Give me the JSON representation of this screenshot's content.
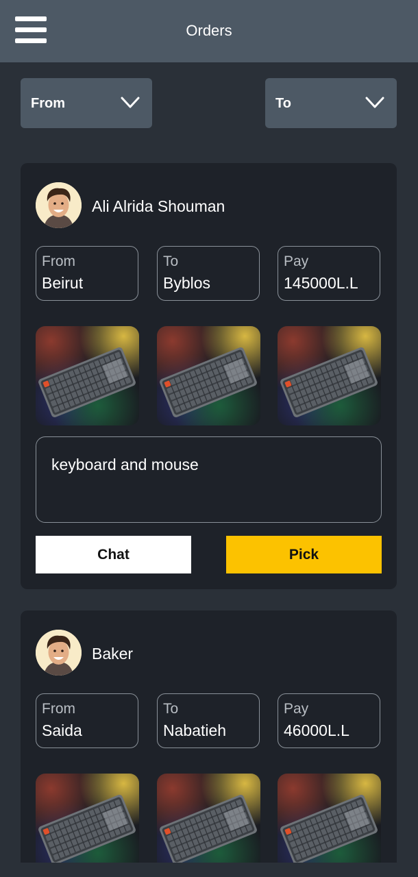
{
  "header": {
    "title": "Orders",
    "menu_icon": "hamburger-menu-icon"
  },
  "filters": {
    "from_label": "From",
    "to_label": "To"
  },
  "orders": [
    {
      "name": "Ali Alrida Shouman",
      "from_label": "From",
      "from": "Beirut",
      "to_label": "To",
      "to": "Byblos",
      "pay_label": "Pay",
      "pay": "145000L.L",
      "description": "keyboard and mouse",
      "chat_label": "Chat",
      "pick_label": "Pick"
    },
    {
      "name": "Baker",
      "from_label": "From",
      "from": "Saida",
      "to_label": "To",
      "to": "Nabatieh",
      "pay_label": "Pay",
      "pay": "46000L.L"
    }
  ],
  "colors": {
    "background": "#2a3038",
    "bar": "#4d5965",
    "card": "#1e2229",
    "accent": "#fcc200"
  }
}
